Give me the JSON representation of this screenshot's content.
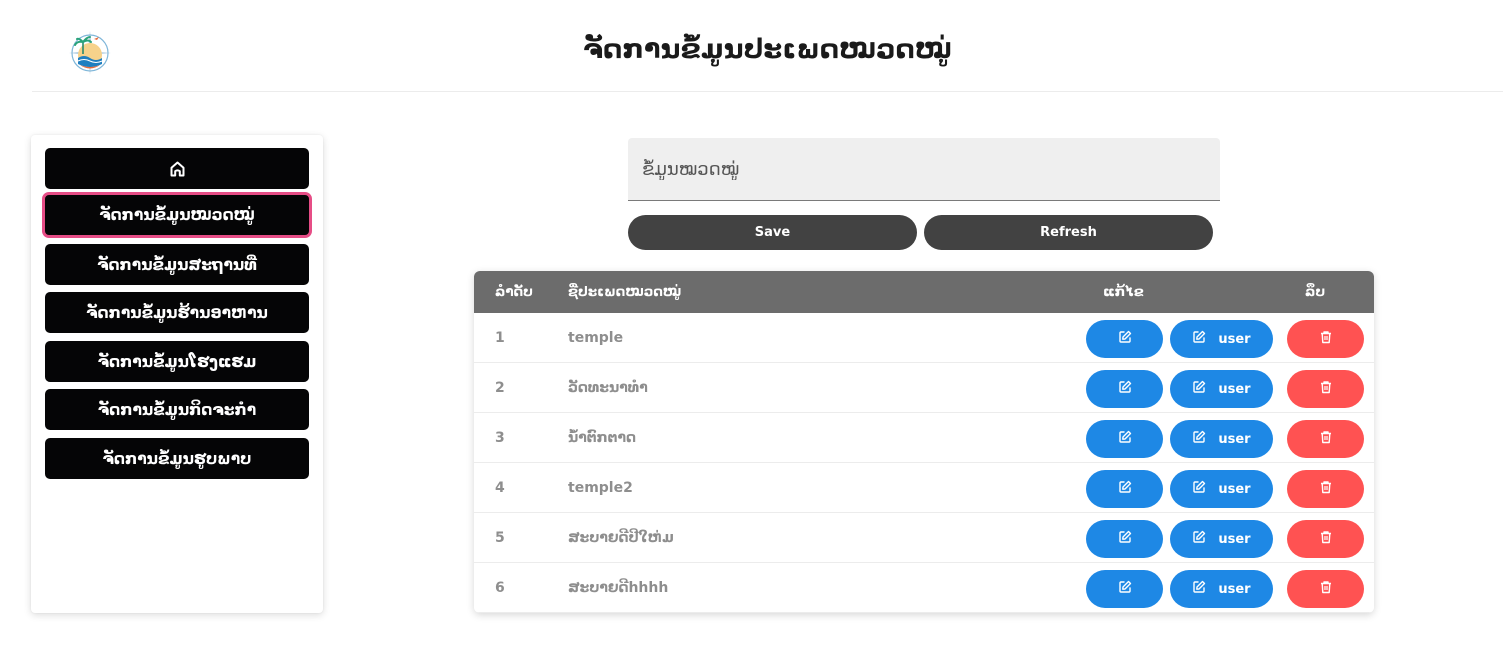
{
  "header": {
    "title": "ຈັດການຂໍ້ມູນປະເພດໝວດໝູ່",
    "logo_icon": "travel-compass-logo"
  },
  "sidebar": {
    "home_icon": "home-icon",
    "items": [
      {
        "label": "ຈັດການຂໍ້ມູນໝວດໝູ່",
        "active": true
      },
      {
        "label": "ຈັດການຂໍ້ມູນສະຖານທີ່"
      },
      {
        "label": "ຈັດການຂໍ້ມູນຮ້ານອາຫານ"
      },
      {
        "label": "ຈັດການຂໍ້ມູນໂຮງແຮມ"
      },
      {
        "label": "ຈັດການຂໍ້ມູນກິດຈະກຳ"
      },
      {
        "label": "ຈັດການຂໍ້ມູນຮູບພາບ"
      }
    ],
    "active_border_color": "#e64d86"
  },
  "form": {
    "category_input": {
      "placeholder": "ຂໍ້ມູນໝວດໝູ່",
      "value": ""
    },
    "save_label": "Save",
    "refresh_label": "Refresh"
  },
  "table": {
    "headers": {
      "index": "ລຳດັບ",
      "name": "ຊື່ປະເພດໝວດໝູ່",
      "edit": "ແກ້ໄຂ",
      "delete": "ລຶບ"
    },
    "user_button_label": "user",
    "rows": [
      {
        "index": "1",
        "name": "temple"
      },
      {
        "index": "2",
        "name": "ວັດທະນາທຳ"
      },
      {
        "index": "3",
        "name": "ນ້ຳຕົກຕາດ"
      },
      {
        "index": "4",
        "name": "temple2"
      },
      {
        "index": "5",
        "name": "ສະບາຍດີປີໃຫ່ມ"
      },
      {
        "index": "6",
        "name": "ສະບາຍດີhhhh"
      }
    ]
  },
  "colors": {
    "edit_button": "#1e88e5",
    "delete_button": "#ff5252",
    "table_header": "#6c6c6c",
    "nav_button": "#050506",
    "form_button": "#424242"
  }
}
